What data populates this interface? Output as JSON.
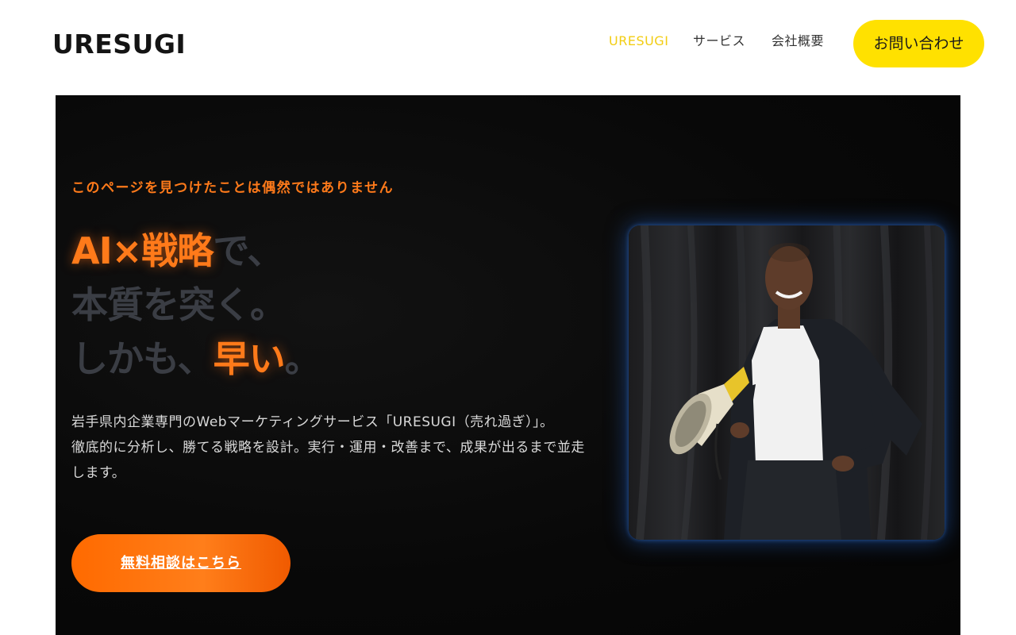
{
  "header": {
    "logo": "URESUGI",
    "nav": {
      "brand": "URESUGI",
      "service": "サービス",
      "company": "会社概要"
    },
    "contact_label": "お問い合わせ"
  },
  "hero": {
    "eyebrow": "このページを見つけたことは偶然ではありません",
    "headline": {
      "line1_accent": "AI×戦略",
      "line1_rest": "で、",
      "line2": "本質を突く。",
      "line3_start": "しかも、",
      "line3_accent": "早い",
      "line3_end": "。"
    },
    "description": {
      "line1": "岩手県内企業専門のWebマーケティングサービス「URESUGI（売れ過ぎ）」。",
      "line2": "徹底的に分析し、勝てる戦略を設計。実行・運用・改善まで、成果が出るまで並走します。"
    },
    "cta_label": "無料相談はこちら",
    "photo": {
      "subject": "man-with-megaphone"
    }
  },
  "colors": {
    "accent_orange": "#ff7a1a",
    "nav_active_yellow": "#f2cd12",
    "contact_button_yellow": "#ffe100",
    "hero_background": "#0a0a0a"
  }
}
